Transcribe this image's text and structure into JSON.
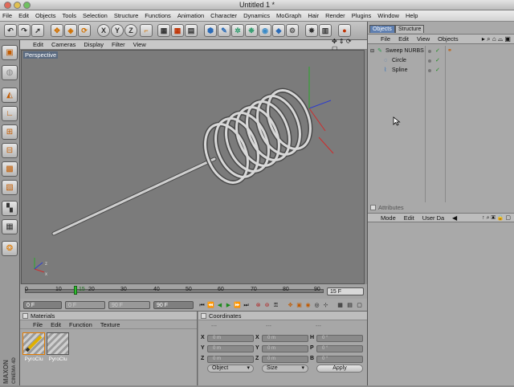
{
  "window": {
    "title": "Untitled 1 *"
  },
  "menubar": [
    "File",
    "Edit",
    "Objects",
    "Tools",
    "Selection",
    "Structure",
    "Functions",
    "Animation",
    "Character",
    "Dynamics",
    "MoGraph",
    "Hair",
    "Render",
    "Plugins",
    "Window",
    "Help"
  ],
  "toolbar": {
    "axis_x": "X",
    "axis_y": "Y",
    "axis_z": "Z"
  },
  "viewport": {
    "menu": [
      "Edit",
      "Cameras",
      "Display",
      "Filter",
      "View"
    ],
    "label": "Perspective"
  },
  "timeline": {
    "ticks": [
      "0",
      "10",
      "20",
      "30",
      "40",
      "50",
      "60",
      "70",
      "80",
      "90"
    ],
    "marker": "15",
    "current_frame": "15 F",
    "start": "0 F",
    "min": "0 F",
    "max": "90 F",
    "end": "90 F"
  },
  "materials": {
    "title": "Materials",
    "menu": [
      "File",
      "Edit",
      "Function",
      "Texture"
    ],
    "items": [
      "PyroClu",
      "PyroClu"
    ]
  },
  "coordinates": {
    "title": "Coordinates",
    "headers": [
      "---",
      "---",
      "---"
    ],
    "rows": [
      {
        "a": "X",
        "av": "0 m",
        "b": "X",
        "bv": "0 m",
        "c": "H",
        "cv": "0 °"
      },
      {
        "a": "Y",
        "av": "0 m",
        "b": "Y",
        "bv": "0 m",
        "c": "P",
        "cv": "0 °"
      },
      {
        "a": "Z",
        "av": "0 m",
        "b": "Z",
        "bv": "0 m",
        "c": "B",
        "cv": "0 °"
      }
    ],
    "mode": "Object",
    "size": "Size",
    "apply": "Apply"
  },
  "object_manager": {
    "tabs": [
      "Objects",
      "Structure"
    ],
    "menu": [
      "File",
      "Edit",
      "View",
      "Objects"
    ],
    "objects": [
      {
        "name": "Sweep NURBS",
        "level": 0
      },
      {
        "name": "Circle",
        "level": 1
      },
      {
        "name": "Spline",
        "level": 1
      }
    ]
  },
  "attributes": {
    "title": "Attributes",
    "menu": [
      "Mode",
      "Edit",
      "User Da"
    ]
  },
  "logo": {
    "line1": "MAXON",
    "line2": "CINEMA 4D"
  },
  "colors": {
    "accent": "#e07a00",
    "viewport_bg": "#7b7b7b",
    "selected_tab": "#5f7fb0"
  }
}
